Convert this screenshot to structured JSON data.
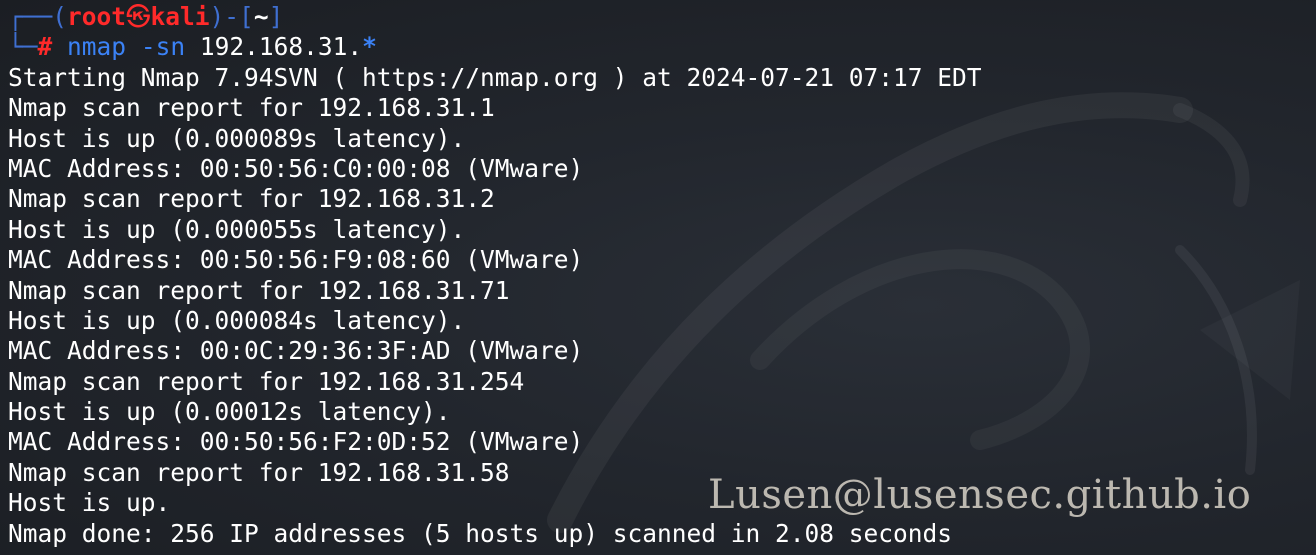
{
  "prompt": {
    "user": "root",
    "separator_icon": "skull-icon",
    "host": "kali",
    "dir": "~",
    "hash": "#",
    "command": "nmap",
    "flag": "-sn",
    "target": "192.168.31.",
    "wildcard": "*"
  },
  "output": [
    "Starting Nmap 7.94SVN ( https://nmap.org ) at 2024-07-21 07:17 EDT",
    "Nmap scan report for 192.168.31.1",
    "Host is up (0.000089s latency).",
    "MAC Address: 00:50:56:C0:00:08 (VMware)",
    "Nmap scan report for 192.168.31.2",
    "Host is up (0.000055s latency).",
    "MAC Address: 00:50:56:F9:08:60 (VMware)",
    "Nmap scan report for 192.168.31.71",
    "Host is up (0.000084s latency).",
    "MAC Address: 00:0C:29:36:3F:AD (VMware)",
    "Nmap scan report for 192.168.31.254",
    "Host is up (0.00012s latency).",
    "MAC Address: 00:50:56:F2:0D:52 (VMware)",
    "Nmap scan report for 192.168.31.58",
    "Host is up.",
    "Nmap done: 256 IP addresses (5 hosts up) scanned in 2.08 seconds"
  ],
  "watermark": "Lusen@lusensec.github.io",
  "colors": {
    "background": "#1e2228",
    "prompt_frame": "#3f6fd1",
    "root": "#ff2a2a",
    "command": "#3b82f6",
    "text": "#ffffff",
    "watermark": "#d8d2c8"
  }
}
